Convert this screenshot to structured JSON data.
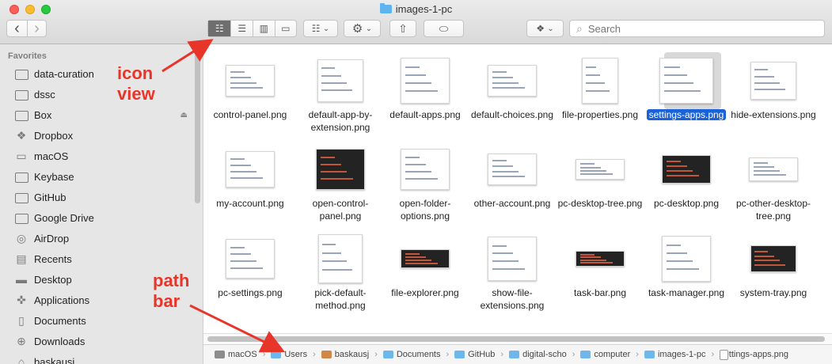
{
  "window": {
    "title": "images-1-pc"
  },
  "toolbar": {
    "back": "‹",
    "forward": "›",
    "view_icons": "☷",
    "view_list": "☰",
    "view_columns": "▥",
    "view_gallery": "▭",
    "group_icon": "☷",
    "group_chev": "⌄",
    "action_icon": "⚙",
    "action_chev": "⌄",
    "share_icon": "⇧",
    "tag_icon": "⬭",
    "dropbox_icon": "❖",
    "dropbox_chev": "⌄",
    "search_placeholder": "Search",
    "search_icon": "⌕"
  },
  "sidebar": {
    "heading": "Favorites",
    "items": [
      {
        "label": "data-curation",
        "icon": "folder-icon",
        "glyph": ""
      },
      {
        "label": "dssc",
        "icon": "folder-icon",
        "glyph": ""
      },
      {
        "label": "Box",
        "icon": "folder-icon",
        "glyph": "",
        "eject": "⏏"
      },
      {
        "label": "Dropbox",
        "icon": "dropbox-icon",
        "glyph": "❖"
      },
      {
        "label": "macOS",
        "icon": "disk-icon",
        "glyph": "▭"
      },
      {
        "label": "Keybase",
        "icon": "folder-icon",
        "glyph": ""
      },
      {
        "label": "GitHub",
        "icon": "folder-icon",
        "glyph": ""
      },
      {
        "label": "Google Drive",
        "icon": "folder-icon",
        "glyph": ""
      },
      {
        "label": "AirDrop",
        "icon": "airdrop-icon",
        "glyph": "◎"
      },
      {
        "label": "Recents",
        "icon": "recents-icon",
        "glyph": "▤"
      },
      {
        "label": "Desktop",
        "icon": "desktop-icon",
        "glyph": "▬"
      },
      {
        "label": "Applications",
        "icon": "applications-icon",
        "glyph": "✜"
      },
      {
        "label": "Documents",
        "icon": "documents-icon",
        "glyph": "▯"
      },
      {
        "label": "Downloads",
        "icon": "downloads-icon",
        "glyph": "⊕"
      },
      {
        "label": "baskausj",
        "icon": "home-icon",
        "glyph": "⌂"
      }
    ]
  },
  "files": [
    {
      "name": "control-panel.png"
    },
    {
      "name": "default-app-by-extension.png"
    },
    {
      "name": "default-apps.png"
    },
    {
      "name": "default-choices.png"
    },
    {
      "name": "file-properties.png"
    },
    {
      "name": "settings-apps.png",
      "selected": true
    },
    {
      "name": "hide-extensions.png"
    },
    {
      "name": "my-account.png"
    },
    {
      "name": "open-control-panel.png"
    },
    {
      "name": "open-folder-options.png"
    },
    {
      "name": "other-account.png"
    },
    {
      "name": "pc-desktop-tree.png"
    },
    {
      "name": "pc-desktop.png"
    },
    {
      "name": "pc-other-desktop-tree.png"
    },
    {
      "name": "pc-settings.png"
    },
    {
      "name": "pick-default-method.png"
    },
    {
      "name": "file-explorer.png"
    },
    {
      "name": "show-file-extensions.png"
    },
    {
      "name": "task-bar.png"
    },
    {
      "name": "task-manager.png"
    },
    {
      "name": "system-tray.png"
    }
  ],
  "pathbar": [
    {
      "label": "macOS",
      "icon": "disk"
    },
    {
      "label": "Users",
      "icon": "folder"
    },
    {
      "label": "baskausj",
      "icon": "home"
    },
    {
      "label": "Documents",
      "icon": "folder"
    },
    {
      "label": "GitHub",
      "icon": "folder"
    },
    {
      "label": "digital-scho",
      "icon": "folder"
    },
    {
      "label": "computer",
      "icon": "folder"
    },
    {
      "label": "images-1-pc",
      "icon": "folder"
    },
    {
      "label": "settings-apps.png",
      "icon": "file"
    }
  ],
  "annotations": {
    "icon_view": [
      "icon",
      "view"
    ],
    "path_bar": [
      "path",
      "bar"
    ],
    "color": "#e8352a"
  }
}
